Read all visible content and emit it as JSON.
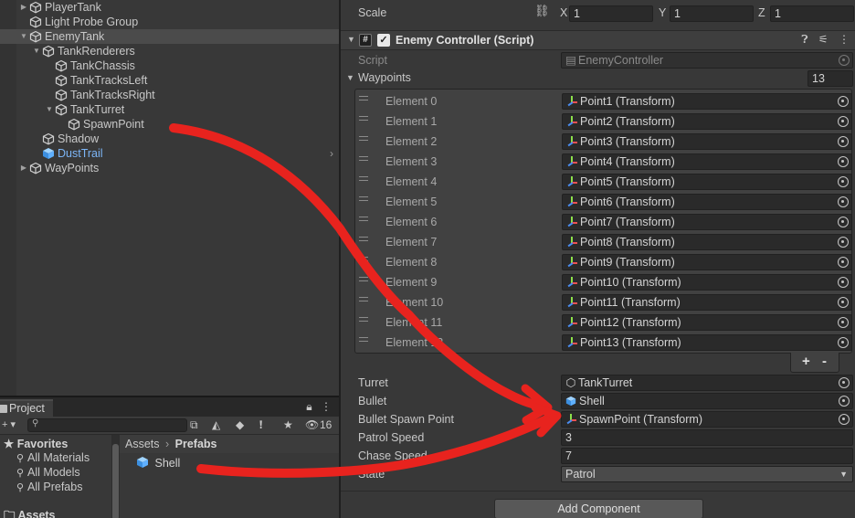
{
  "hierarchy": {
    "items": [
      {
        "label": "PlayerTank",
        "depth": 1,
        "arrow": "▶",
        "kind": "object"
      },
      {
        "label": "Light Probe Group",
        "depth": 1,
        "arrow": "",
        "kind": "object"
      },
      {
        "label": "EnemyTank",
        "depth": 1,
        "arrow": "▼",
        "kind": "object",
        "selected": true
      },
      {
        "label": "TankRenderers",
        "depth": 2,
        "arrow": "▼",
        "kind": "object"
      },
      {
        "label": "TankChassis",
        "depth": 3,
        "arrow": "",
        "kind": "object"
      },
      {
        "label": "TankTracksLeft",
        "depth": 3,
        "arrow": "",
        "kind": "object"
      },
      {
        "label": "TankTracksRight",
        "depth": 3,
        "arrow": "",
        "kind": "object"
      },
      {
        "label": "TankTurret",
        "depth": 3,
        "arrow": "▼",
        "kind": "object"
      },
      {
        "label": "SpawnPoint",
        "depth": 4,
        "arrow": "",
        "kind": "object"
      },
      {
        "label": "Shadow",
        "depth": 2,
        "arrow": "",
        "kind": "object"
      },
      {
        "label": "DustTrail",
        "depth": 2,
        "arrow": "",
        "kind": "prefab",
        "more": "›"
      },
      {
        "label": "WayPoints",
        "depth": 1,
        "arrow": "▶",
        "kind": "object"
      }
    ]
  },
  "project": {
    "tab_label": "Project",
    "tab_icons": "⋮",
    "lock_icon": "🔒",
    "hidden_count": "16",
    "favorites_header": "Favorites",
    "favorites": [
      "All Materials",
      "All Models",
      "All Prefabs"
    ],
    "assets_header": "Assets",
    "breadcrumb": {
      "root": "Assets",
      "sep": "›",
      "current": "Prefabs"
    },
    "assets": [
      {
        "label": "Shell"
      }
    ]
  },
  "inspector": {
    "scale": {
      "label": "Scale",
      "x_label": "X",
      "x": "1",
      "y_label": "Y",
      "y": "1",
      "z_label": "Z",
      "z": "1"
    },
    "component_title": "Enemy Controller (Script)",
    "script": {
      "label": "Script",
      "value": "EnemyController"
    },
    "waypoints": {
      "label": "Waypoints",
      "count": "13",
      "elements": [
        {
          "label": "Element 0",
          "value": "Point1 (Transform)"
        },
        {
          "label": "Element 1",
          "value": "Point2 (Transform)"
        },
        {
          "label": "Element 2",
          "value": "Point3 (Transform)"
        },
        {
          "label": "Element 3",
          "value": "Point4 (Transform)"
        },
        {
          "label": "Element 4",
          "value": "Point5 (Transform)"
        },
        {
          "label": "Element 5",
          "value": "Point6 (Transform)"
        },
        {
          "label": "Element 6",
          "value": "Point7 (Transform)"
        },
        {
          "label": "Element 7",
          "value": "Point8 (Transform)"
        },
        {
          "label": "Element 8",
          "value": "Point9 (Transform)"
        },
        {
          "label": "Element 9",
          "value": "Point10 (Transform)"
        },
        {
          "label": "Element 10",
          "value": "Point11 (Transform)"
        },
        {
          "label": "Element 11",
          "value": "Point12 (Transform)"
        },
        {
          "label": "Element 12",
          "value": "Point13 (Transform)"
        }
      ],
      "add_label": "+",
      "remove_label": "-"
    },
    "turret": {
      "label": "Turret",
      "value": "TankTurret"
    },
    "bullet": {
      "label": "Bullet",
      "value": "Shell"
    },
    "bullet_spawn": {
      "label": "Bullet Spawn Point",
      "value": "SpawnPoint (Transform)"
    },
    "patrol_speed": {
      "label": "Patrol Speed",
      "value": "3"
    },
    "chase_speed": {
      "label": "Chase Speed",
      "value": "7"
    },
    "state": {
      "label": "State",
      "value": "Patrol"
    },
    "add_component": "Add Component"
  },
  "colors": {
    "annotation": "#e8231e",
    "prefab_text": "#7cb5f6",
    "panel_bg": "#383838"
  },
  "icons": {
    "object": "cube-outline-icon",
    "prefab": "blue-cube-icon",
    "favorite": "star-icon",
    "search": "magnifier-icon",
    "folder": "folder-icon",
    "script": "hash-icon",
    "transform": "transform-axes-icon",
    "picker": "object-picker-icon"
  }
}
